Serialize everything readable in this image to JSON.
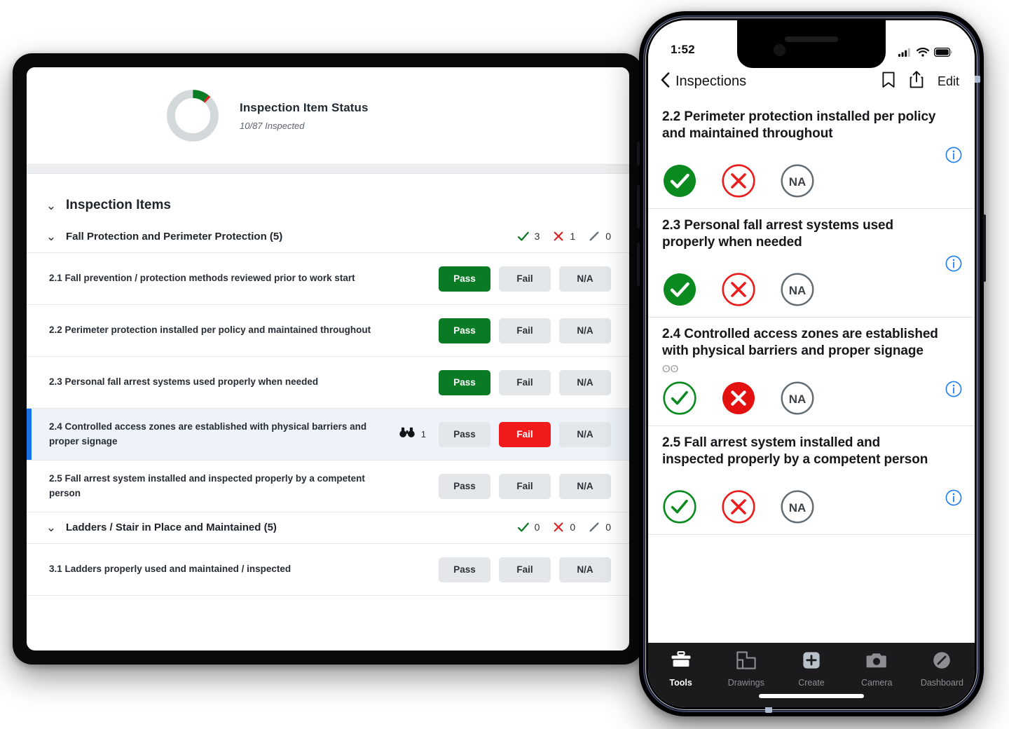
{
  "desktop": {
    "dashboard": {
      "title": "Inspection Item Status",
      "subtitle": "10/87 Inspected"
    },
    "section": {
      "label": "Inspection Items"
    },
    "groups": [
      {
        "name": "Fall Protection and Perimeter Protection (5)",
        "stats": {
          "pass": "3",
          "fail": "1",
          "na": "0"
        },
        "items": [
          {
            "text": "2.1 Fall prevention / protection methods reviewed prior to work start",
            "state": "pass",
            "observations": ""
          },
          {
            "text": "2.2 Perimeter protection installed per policy and maintained throughout",
            "state": "pass",
            "observations": ""
          },
          {
            "text": "2.3 Personal fall arrest systems used properly when needed",
            "state": "pass",
            "observations": ""
          },
          {
            "text": "2.4 Controlled access zones are established with physical barriers and proper signage",
            "state": "fail",
            "observations": "1"
          },
          {
            "text": "2.5 Fall arrest system installed and inspected properly by a competent person",
            "state": "none",
            "observations": ""
          }
        ]
      },
      {
        "name": "Ladders / Stair in Place and Maintained (5)",
        "stats": {
          "pass": "0",
          "fail": "0",
          "na": "0"
        },
        "items": [
          {
            "text": "3.1 Ladders properly used and maintained / inspected",
            "state": "none",
            "observations": ""
          }
        ]
      }
    ],
    "buttons": {
      "pass": "Pass",
      "fail": "Fail",
      "na": "N/A"
    }
  },
  "phone": {
    "status_bar": {
      "time": "1:52"
    },
    "nav": {
      "back_label": "Inspections",
      "edit_label": "Edit"
    },
    "items": [
      {
        "text": "2.2 Perimeter protection installed per policy and maintained throughout",
        "state": "pass",
        "observations": ""
      },
      {
        "text": "2.3 Personal fall arrest systems used properly when needed",
        "state": "pass",
        "observations": ""
      },
      {
        "text": "2.4 Controlled access zones are established with physical barriers and proper signage",
        "state": "fail",
        "observations": "ʘʘ"
      },
      {
        "text": "2.5 Fall arrest system installed and inspected properly by a competent person",
        "state": "none",
        "observations": ""
      }
    ],
    "na_label": "NA",
    "tabs": [
      {
        "label": "Tools",
        "icon": "toolbox-icon",
        "active": true
      },
      {
        "label": "Drawings",
        "icon": "floorplan-icon",
        "active": false
      },
      {
        "label": "Create",
        "icon": "plus-square-icon",
        "active": false
      },
      {
        "label": "Camera",
        "icon": "camera-icon",
        "active": false
      },
      {
        "label": "Dashboard",
        "icon": "gauge-icon",
        "active": false
      }
    ]
  },
  "chart_data": {
    "type": "pie",
    "title": "Inspection Item Status",
    "subtitle": "10/87 Inspected",
    "categories": [
      "Pass",
      "Fail",
      "Not Inspected"
    ],
    "values": [
      9,
      1,
      77
    ],
    "colors": [
      "#0b7a25",
      "#e02020",
      "#d3d9da"
    ],
    "total": 87,
    "legend": false
  },
  "colors": {
    "pass_green": "#0b7a25",
    "fail_red": "#f21b1b",
    "accent_blue": "#1a73e8",
    "info_blue": "#1a7af0",
    "neutral_gray": "#d3d9da"
  }
}
